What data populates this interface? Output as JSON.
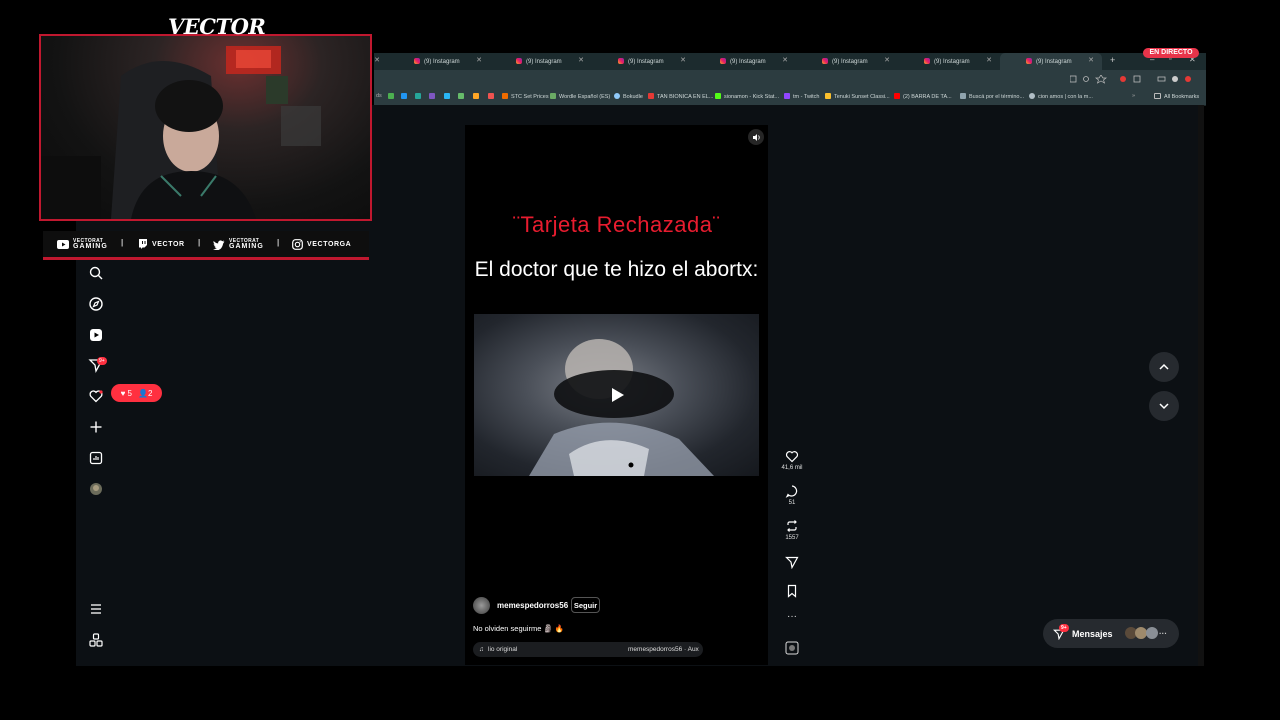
{
  "stream": {
    "logo": "VECTOR",
    "live_badge": "EN DIRECTO",
    "socials": [
      {
        "icon": "youtube-icon",
        "top": "VECTORAT",
        "bottom": "GAMING"
      },
      {
        "icon": "twitch-icon",
        "label": "VECTOR"
      },
      {
        "icon": "twitter-icon",
        "top": "VECTORAT",
        "bottom": "GAMING"
      },
      {
        "icon": "instagram-icon",
        "label": "VECTORGA"
      }
    ]
  },
  "browser": {
    "tabs": [
      {
        "title": "(9) Instagram"
      },
      {
        "title": "(9) Instagram"
      },
      {
        "title": "(9) Instagram"
      },
      {
        "title": "(9) Instagram"
      },
      {
        "title": "(9) Instagram"
      },
      {
        "title": "(9) Instagram"
      },
      {
        "title": "(9) Instagram",
        "active": true
      }
    ],
    "bookmarks": [
      "STC Set Prices",
      "Wordle Español (ES)",
      "Bokudle",
      "TAN BIONICA EN EL...",
      "sionamon - Kick Stat...",
      "tm - Twitch",
      "Tenuki Sunset Classi...",
      "(2) BARRA DE TA...",
      "Buscá por el término...",
      "cion amos | con la m..."
    ],
    "all_bookmarks": "All Bookmarks"
  },
  "sidebar": {
    "items": [
      "search-icon",
      "explore-icon",
      "reels-icon",
      "direct-icon",
      "heart-icon",
      "create-icon",
      "dashboard-icon",
      "profile-avatar"
    ],
    "direct_badge": "9+",
    "notifications": {
      "likes": "5",
      "follows": "2"
    },
    "bottom": [
      "menu-icon",
      "threads-icon"
    ]
  },
  "reel": {
    "title": "¨Tarjeta Rechazada¨",
    "caption": "El doctor que te hizo el abortx:",
    "author": "memespedorros56",
    "follow_label": "Seguir",
    "description": "No olviden seguirme 🗿 🔥",
    "audio_label": "lio original",
    "audio_author": "memespedorros56 · Aux",
    "likes": "41,6 mil",
    "comments": "51",
    "reposts": "1557"
  },
  "messages": {
    "label": "Mensajes",
    "badge": "9+"
  }
}
